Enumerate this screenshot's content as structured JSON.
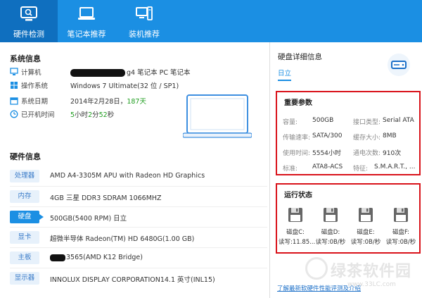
{
  "tabs": [
    {
      "label": "硬件检测",
      "icon": "monitor-check-icon",
      "active": true
    },
    {
      "label": "笔记本推荐",
      "icon": "laptop-icon",
      "active": false
    },
    {
      "label": "装机推荐",
      "icon": "desktop-pc-icon",
      "active": false
    }
  ],
  "system": {
    "title": "系统信息",
    "computer": {
      "label": "计算机",
      "value": "g4 笔记本 PC 笔记本"
    },
    "os": {
      "label": "操作系统",
      "value": "Windows 7 Ultimate(32 位 /  SP1)"
    },
    "date": {
      "label": "系统日期",
      "value_prefix": "2014年2月28日，",
      "days": "187天"
    },
    "uptime": {
      "label": "已开机时间",
      "h": "5",
      "h_unit": "小时",
      "m": "2",
      "m_unit": "分",
      "s": "52",
      "s_unit": "秒"
    }
  },
  "hardware": {
    "title": "硬件信息",
    "items": [
      {
        "tag": "处理器",
        "value": "AMD A4-3305M APU with Radeon HD Graphics",
        "active": false
      },
      {
        "tag": "内存",
        "value": "4GB 三星 DDR3 SDRAM 1066MHZ",
        "active": false
      },
      {
        "tag": "硬盘",
        "value": "500GB(5400 RPM) 日立",
        "active": true
      },
      {
        "tag": "显卡",
        "value": "超微半导体 Radeon(TM) HD 6480G(1.00 GB)",
        "active": false
      },
      {
        "tag": "主板",
        "value": "3565(AMD K12 Bridge)",
        "active": false
      },
      {
        "tag": "显示器",
        "value": "INNOLUX DISPLAY CORPORATION14.1 英寸(INL15)",
        "active": false
      }
    ]
  },
  "disk_detail": {
    "title": "硬盘详细信息",
    "tab": "日立",
    "params_title": "重要参数",
    "params": [
      {
        "label": "容量:",
        "value": "500GB"
      },
      {
        "label": "接口类型:",
        "value": "Serial ATA"
      },
      {
        "label": "传输速率:",
        "value": "SATA/300"
      },
      {
        "label": "缓存大小:",
        "value": "8MB"
      },
      {
        "label": "使用时间:",
        "value": "5554小时"
      },
      {
        "label": "通电次数:",
        "value": "910次"
      },
      {
        "label": "标准:",
        "value": "ATA8-ACS"
      },
      {
        "label": "特征:",
        "value": "S.M.A.R.T., ..."
      }
    ],
    "status_title": "运行状态",
    "drives": [
      {
        "name": "磁盘C:",
        "rw": "读写:11.85..."
      },
      {
        "name": "磁盘D:",
        "rw": "读写:0B/秒"
      },
      {
        "name": "磁盘E:",
        "rw": "读写:0B/秒"
      },
      {
        "name": "磁盘F:",
        "rw": "读写:0B/秒"
      }
    ],
    "footer_link": "了解最新软硬件性能评测及介绍"
  },
  "watermark": {
    "text": "绿茶软件园",
    "url": "www.33LC.com"
  },
  "colors": {
    "accent": "#1b8fe3",
    "highlight_box": "#d9121a",
    "green": "#1f9d1f"
  }
}
